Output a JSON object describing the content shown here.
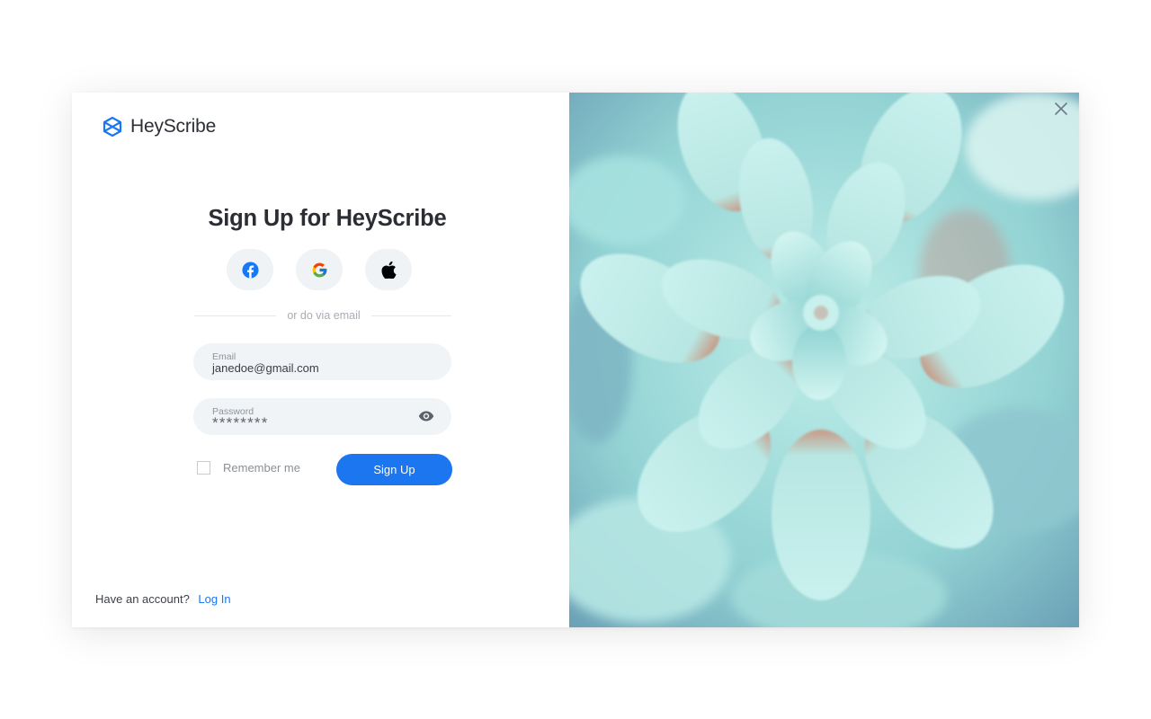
{
  "app": {
    "name": "HeyScribe",
    "accent_color": "#1b76f0"
  },
  "form": {
    "title": "Sign Up for HeyScribe",
    "social": [
      {
        "name": "facebook",
        "icon": "facebook-icon"
      },
      {
        "name": "google",
        "icon": "google-icon"
      },
      {
        "name": "apple",
        "icon": "apple-icon"
      }
    ],
    "divider_text": "or do via email",
    "email": {
      "label": "Email",
      "value": "janedoe@gmail.com"
    },
    "password": {
      "label": "Password",
      "value": "********",
      "toggle_icon": "eye-icon"
    },
    "remember_label": "Remember me",
    "remember_checked": false,
    "submit_label": "Sign Up"
  },
  "footer": {
    "prompt": "Have an account?",
    "link_label": "Log In"
  },
  "hero": {
    "description_icon": "succulent-photo"
  },
  "close_icon": "close-icon"
}
